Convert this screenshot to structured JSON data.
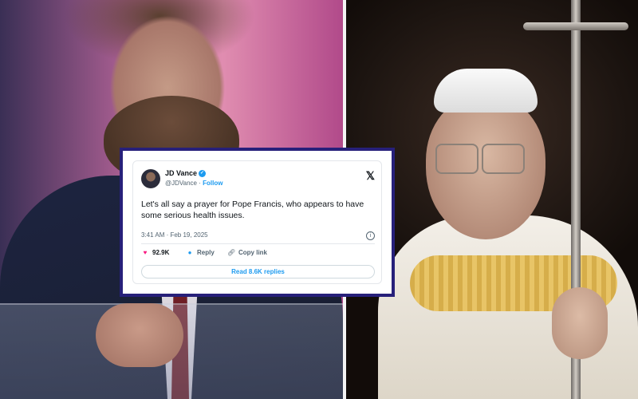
{
  "tweet": {
    "author_name": "JD Vance",
    "handle": "@JDVance",
    "separator": " · ",
    "follow_label": "Follow",
    "text": "Let's all say a prayer for Pope Francis, who appears to have some serious health issues.",
    "timestamp": "3:41 AM · Feb 19, 2025",
    "likes": "92.9K",
    "reply_label": "Reply",
    "copy_link_label": "Copy link",
    "read_replies_label": "Read 8.6K replies",
    "platform_icon": "x-logo-icon"
  },
  "colors": {
    "frame_border": "#27207a",
    "link_blue": "#1d9bf0",
    "like_pink": "#f91880",
    "text_dark": "#0f1419",
    "text_muted": "#536471"
  }
}
